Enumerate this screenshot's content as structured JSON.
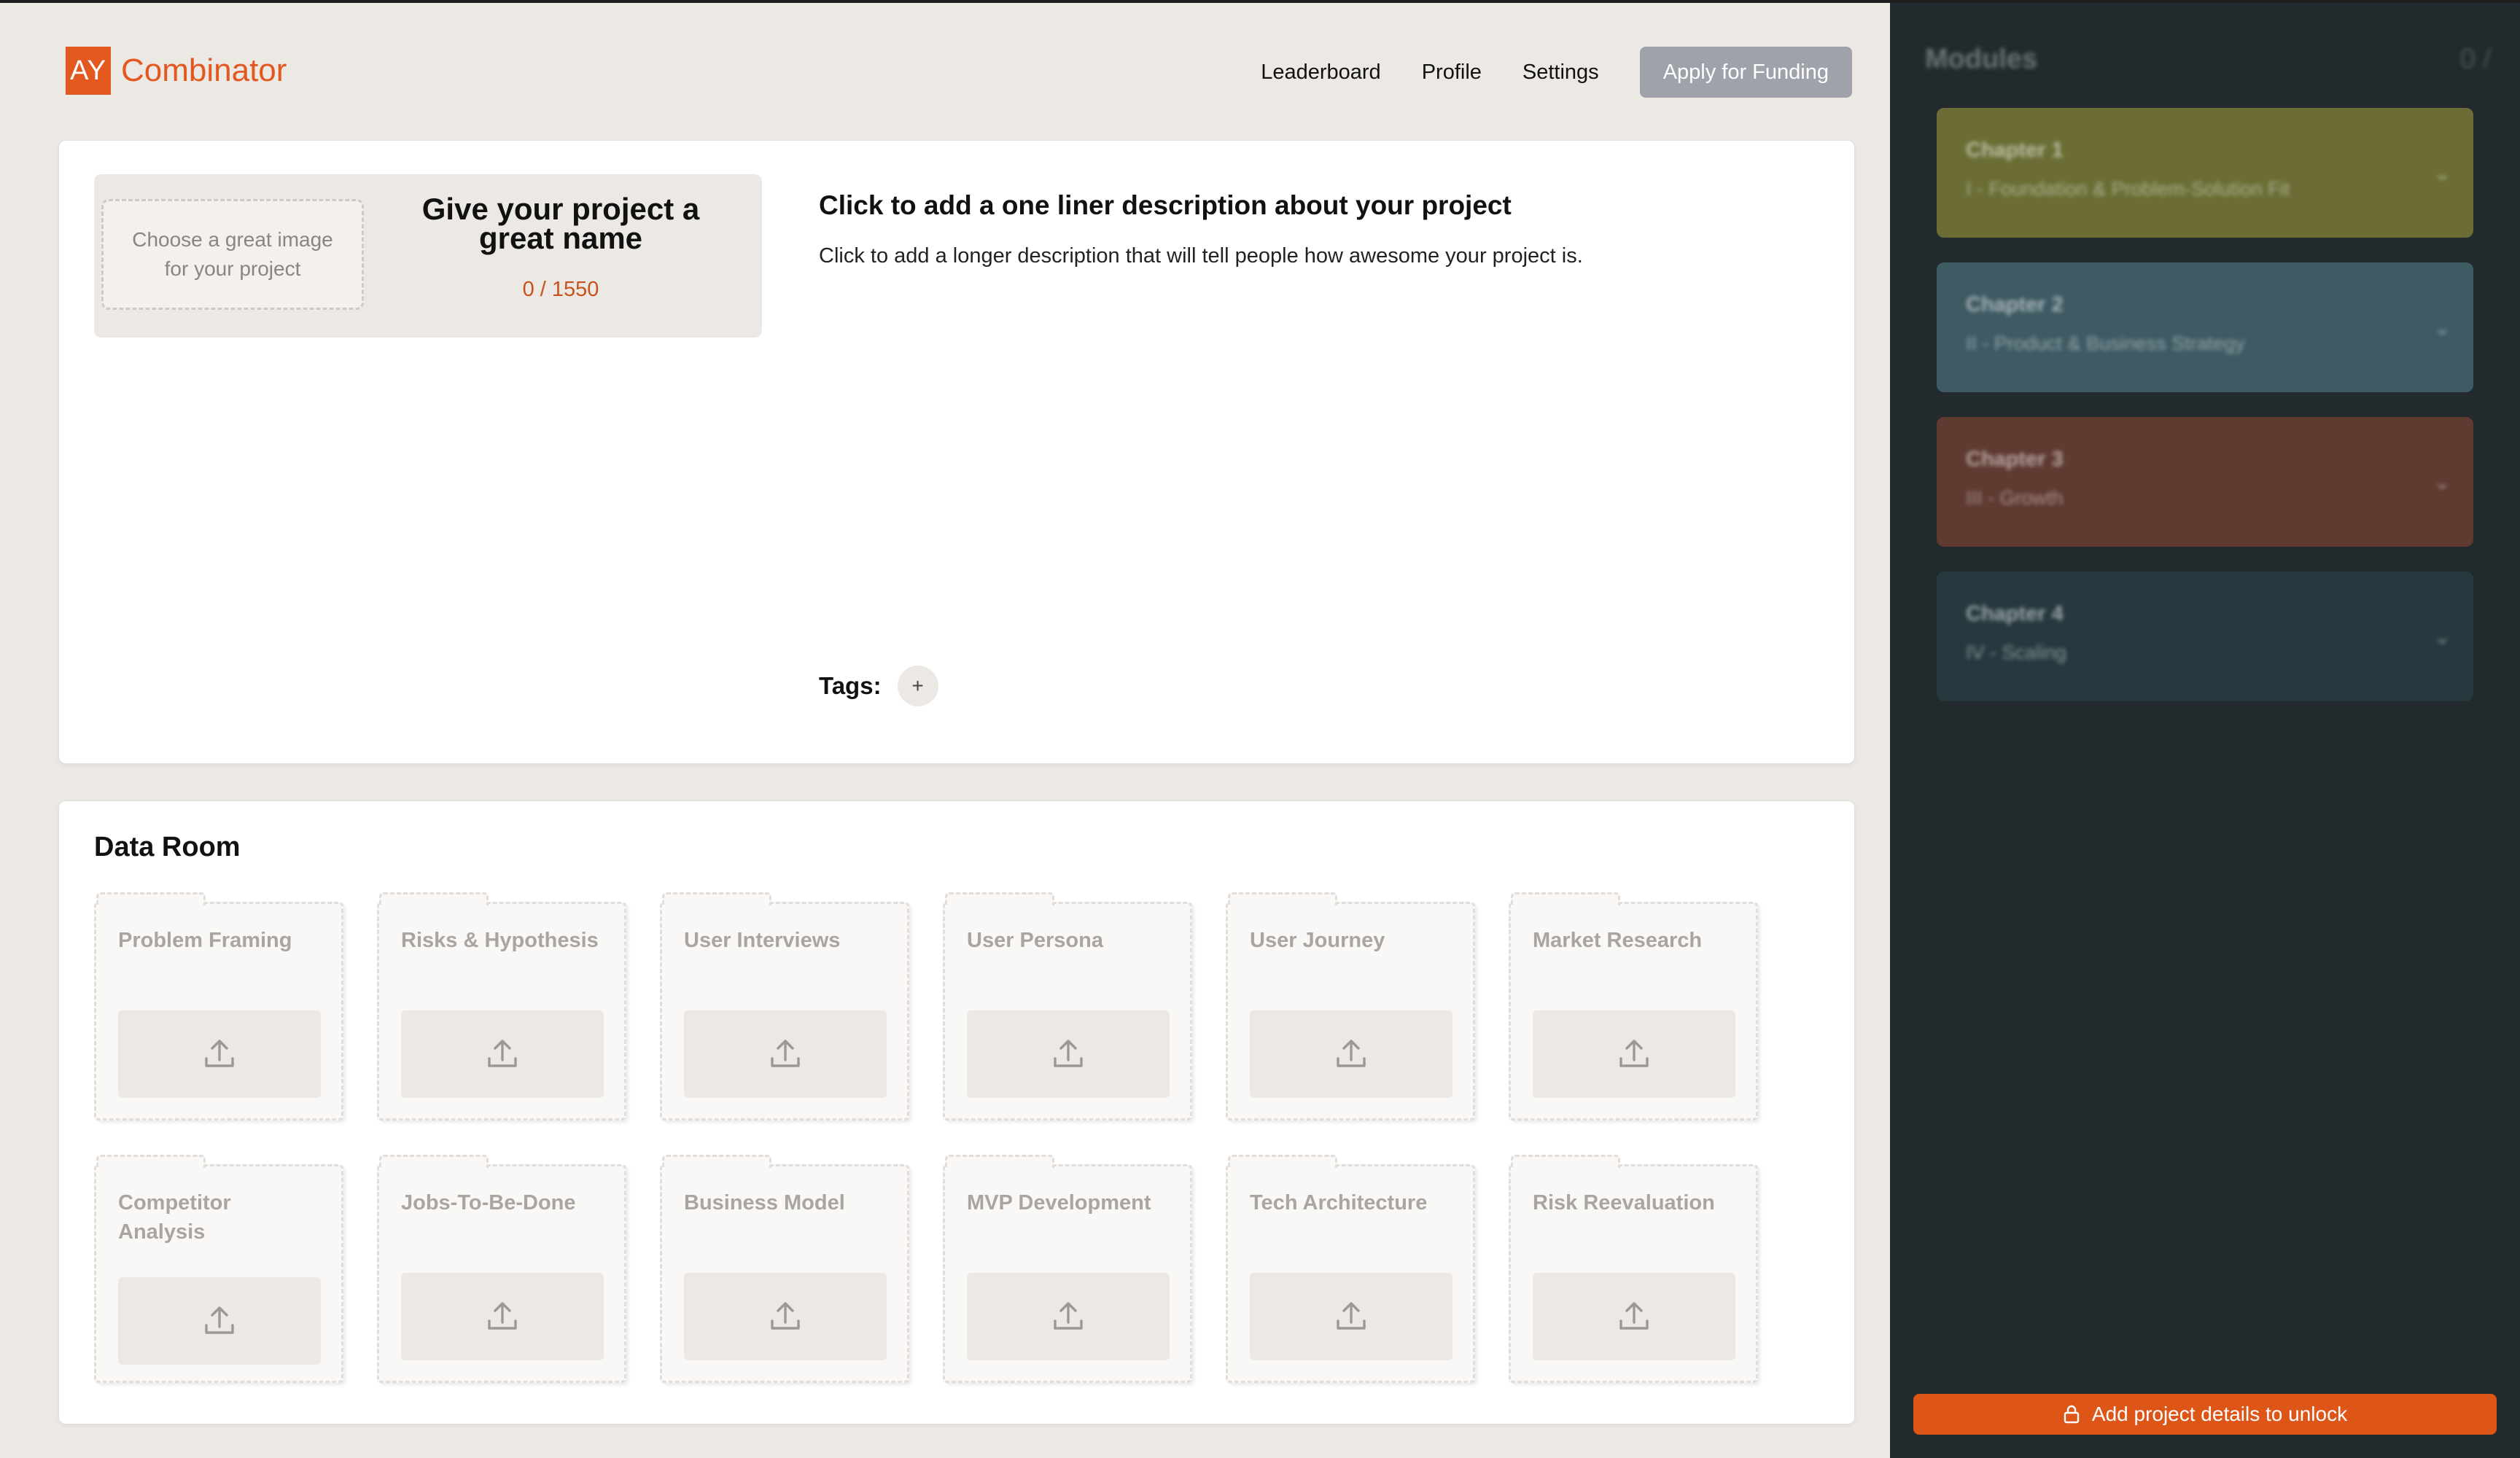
{
  "colors": {
    "accent": "#E2581E",
    "sidebar_bg": "#232A2E",
    "page_bg": "#ECE8E4"
  },
  "brand": {
    "logo_mark": "AY",
    "logo_text": "Combinator"
  },
  "nav": {
    "links": [
      "Leaderboard",
      "Profile",
      "Settings"
    ],
    "apply_label": "Apply for Funding"
  },
  "project": {
    "image_placeholder": "Choose a great image for your project",
    "name_placeholder": "Give your project a great name",
    "char_count": "0 / 1550",
    "oneliner_placeholder": "Click to add a one liner description about your project",
    "description_placeholder": "Click to add a longer description that will tell people how awesome your project is.",
    "tags_label": "Tags:",
    "tag_add_label": "+"
  },
  "data_room": {
    "title": "Data Room",
    "folders": [
      {
        "title": "Problem Framing",
        "icon": "upload-icon"
      },
      {
        "title": "Risks & Hypothesis",
        "icon": "upload-icon"
      },
      {
        "title": "User Interviews",
        "icon": "upload-icon"
      },
      {
        "title": "User Persona",
        "icon": "upload-icon"
      },
      {
        "title": "User Journey",
        "icon": "upload-icon"
      },
      {
        "title": "Market Research",
        "icon": "upload-icon"
      },
      {
        "title": "Competitor Analysis",
        "icon": "upload-icon"
      },
      {
        "title": "Jobs-To-Be-Done",
        "icon": "upload-icon"
      },
      {
        "title": "Business Model",
        "icon": "upload-icon"
      },
      {
        "title": "MVP Development",
        "icon": "upload-icon"
      },
      {
        "title": "Tech Architecture",
        "icon": "upload-icon"
      },
      {
        "title": "Risk Reevaluation",
        "icon": "upload-icon"
      }
    ]
  },
  "sidebar": {
    "title": "Modules",
    "count": "0 /",
    "chapters": [
      {
        "name": "Chapter 1",
        "subtitle": "I - Foundation & Problem-Solution Fit",
        "color": "#6B6D35"
      },
      {
        "name": "Chapter 2",
        "subtitle": "II - Product & Business Strategy",
        "color": "#3E5A63"
      },
      {
        "name": "Chapter 3",
        "subtitle": "III - Growth",
        "color": "#5E3A31"
      },
      {
        "name": "Chapter 4",
        "subtitle": "IV - Scaling",
        "color": "#25393F"
      }
    ],
    "unlock_label": "Add project details to unlock"
  }
}
